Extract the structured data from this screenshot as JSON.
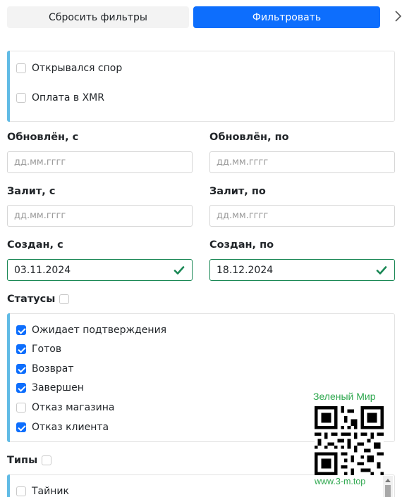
{
  "toolbar": {
    "reset_label": "Сбросить фильтры",
    "filter_label": "Фильтровать"
  },
  "flags": [
    {
      "label": "Открывался спор",
      "checked": false
    },
    {
      "label": "Оплата в XMR",
      "checked": false
    }
  ],
  "dates": {
    "updated_from_label": "Обновлён, с",
    "updated_to_label": "Обновлён, по",
    "updated_from_placeholder": "дд.мм.гггг",
    "updated_to_placeholder": "дд.мм.гггг",
    "filled_from_label": "Залит, с",
    "filled_to_label": "Залит, по",
    "filled_from_placeholder": "дд.мм.гггг",
    "filled_to_placeholder": "дд.мм.гггг",
    "created_from_label": "Создан, с",
    "created_to_label": "Создан, по",
    "created_from_value": "03.11.2024",
    "created_to_value": "18.12.2024"
  },
  "statuses": {
    "label": "Статусы",
    "items": [
      {
        "label": "Ожидает подтверждения",
        "checked": true
      },
      {
        "label": "Готов",
        "checked": true
      },
      {
        "label": "Возврат",
        "checked": true
      },
      {
        "label": "Завершен",
        "checked": true
      },
      {
        "label": "Отказ магазина",
        "checked": false
      },
      {
        "label": "Отказ клиента",
        "checked": true
      }
    ]
  },
  "types": {
    "label": "Типы",
    "items": [
      {
        "label": "Тайник",
        "checked": false
      }
    ]
  },
  "watermark": {
    "title": "Зеленый Мир",
    "url": "www.3-m.top"
  },
  "colors": {
    "primary": "#0d6efd",
    "accent": "#61bbe5",
    "valid": "#198754",
    "watermark": "#2fa84f"
  }
}
